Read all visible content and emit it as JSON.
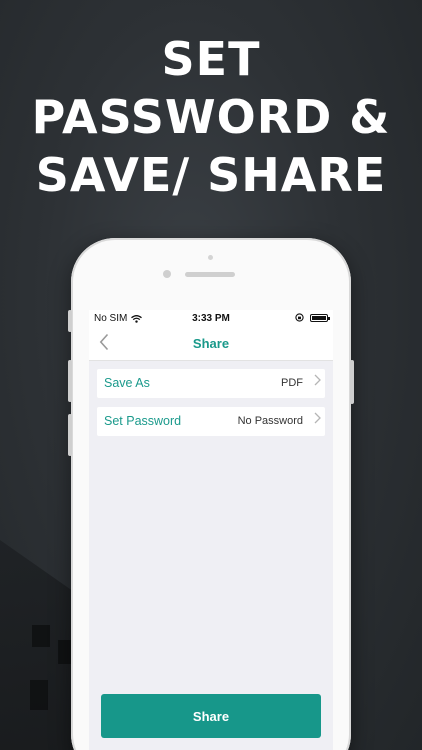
{
  "headline": {
    "line1": "SET",
    "line2": "PASSWORD &",
    "line3": "SAVE/ SHARE"
  },
  "statusbar": {
    "carrier": "No SIM",
    "time": "3:33 PM"
  },
  "navbar": {
    "title": "Share"
  },
  "rows": [
    {
      "label": "Save As",
      "value": "PDF"
    },
    {
      "label": "Set Password",
      "value": "No Password"
    }
  ],
  "share_button": {
    "label": "Share"
  },
  "colors": {
    "accent": "#17978a",
    "background": "#2d3135",
    "screen_bg": "#efeff4"
  },
  "icons": {
    "back": "chevron-left-icon",
    "row_chevron": "chevron-right-icon",
    "wifi": "wifi-icon",
    "battery": "battery-icon",
    "rotation_lock": "rotation-lock-icon"
  }
}
